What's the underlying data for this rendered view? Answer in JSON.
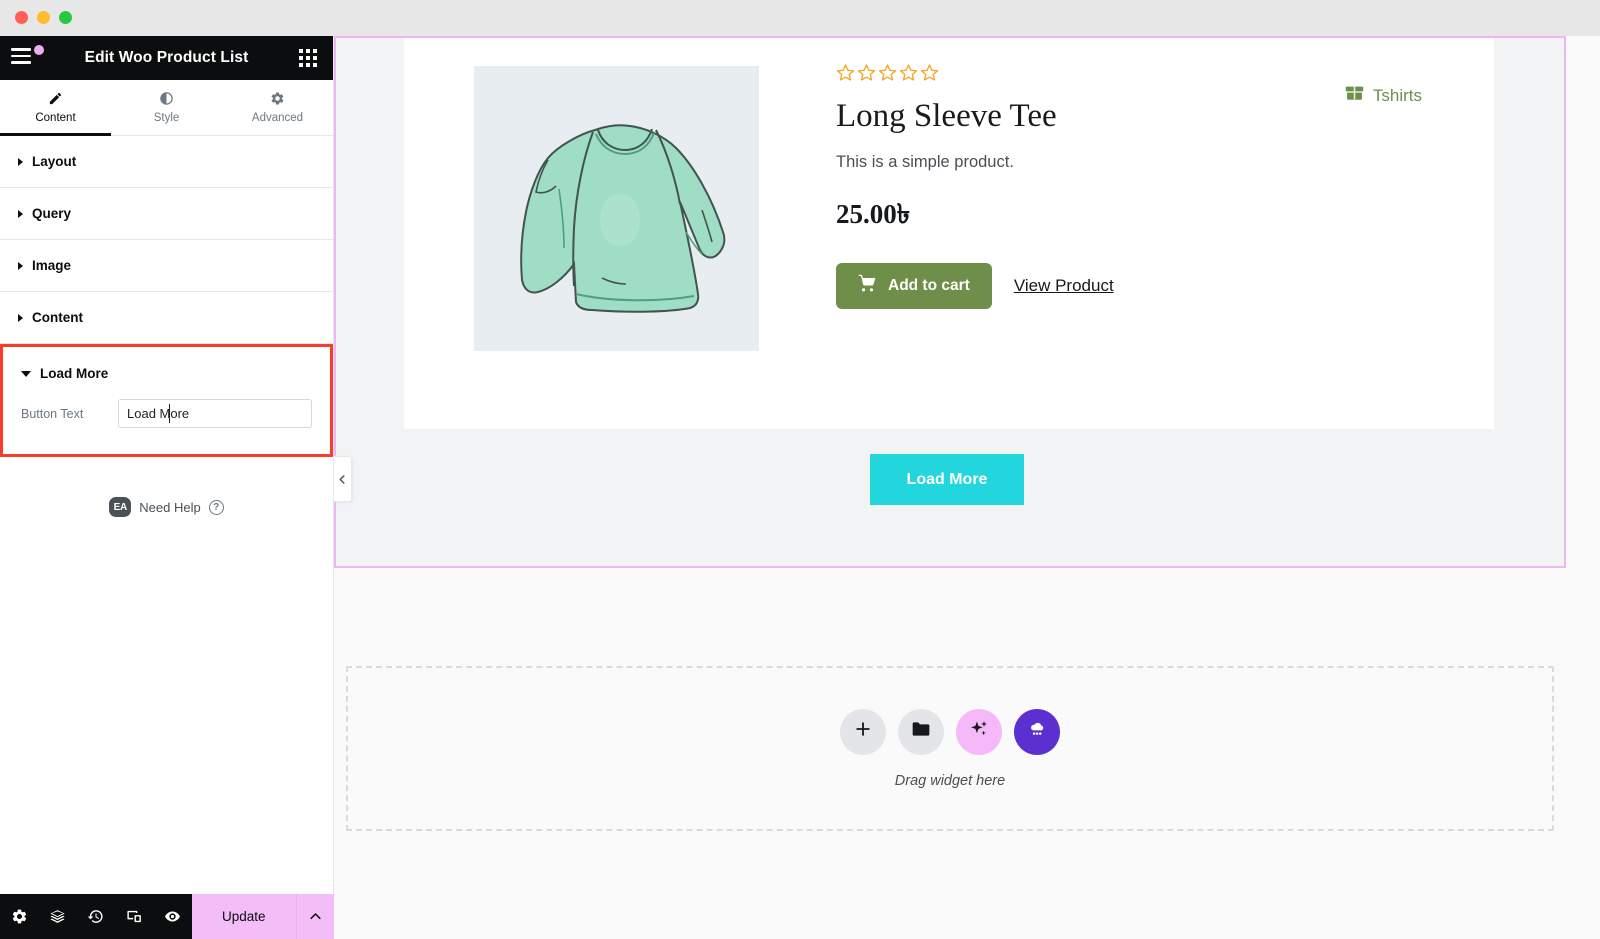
{
  "window": {
    "traffic_lights": [
      "close",
      "minimize",
      "zoom"
    ]
  },
  "panel": {
    "title": "Edit Woo Product List",
    "menu_icon": "hamburger-icon",
    "grid_icon": "apps-grid-icon",
    "tabs": [
      {
        "label": "Content",
        "icon": "pencil-icon",
        "active": true
      },
      {
        "label": "Style",
        "icon": "contrast-icon",
        "active": false
      },
      {
        "label": "Advanced",
        "icon": "gear-icon",
        "active": false
      }
    ],
    "sections": [
      {
        "label": "Layout",
        "open": false
      },
      {
        "label": "Query",
        "open": false
      },
      {
        "label": "Image",
        "open": false
      },
      {
        "label": "Content",
        "open": false
      },
      {
        "label": "Load More",
        "open": true,
        "highlighted": true
      }
    ],
    "controls": {
      "button_text_label": "Button Text",
      "button_text_value": "Load More",
      "button_text_placeholder": "Load More"
    },
    "need_help": {
      "badge": "EA",
      "label": "Need Help",
      "help_icon": "question-mark-icon"
    },
    "footer": {
      "icons": [
        {
          "name": "settings-gear-icon"
        },
        {
          "name": "navigator-layers-icon"
        },
        {
          "name": "history-clock-icon"
        },
        {
          "name": "responsive-devices-icon"
        },
        {
          "name": "preview-eye-icon"
        }
      ],
      "update_label": "Update",
      "caret_icon": "chevron-up-icon"
    },
    "collapse_handle_icon": "chevron-left-icon",
    "highlight_color": "#fa3c2a"
  },
  "canvas": {
    "selection_border_color": "#efb6f5",
    "product": {
      "rating_stars": 5,
      "rating_filled": 0,
      "star_color": "#f5a623",
      "title": "Long Sleeve Tee",
      "description": "This is a simple product.",
      "price": "25.00৳",
      "add_to_cart_label": "Add to cart",
      "add_to_cart_icon": "shopping-cart-icon",
      "add_to_cart_color": "#6f8e4a",
      "view_product_label": "View Product",
      "category_label": "Tshirts",
      "category_icon": "folder-box-icon",
      "category_color": "#6f8e4a",
      "image_alt": "mint green long sleeve tee illustration",
      "image_bg": "#e7edf0",
      "shirt_color": "#9fddc5"
    },
    "load_more_button": {
      "label": "Load More",
      "color": "#23d5dd"
    },
    "dropzone": {
      "label": "Drag widget here",
      "buttons": [
        {
          "name": "add-element-button",
          "icon": "plus-icon",
          "style": "grey"
        },
        {
          "name": "add-template-button",
          "icon": "folder-icon",
          "style": "grey"
        },
        {
          "name": "ai-button",
          "icon": "sparkles-icon",
          "style": "pink"
        },
        {
          "name": "app-cloud-button",
          "icon": "cloud-dots-icon",
          "style": "purple"
        }
      ]
    }
  }
}
